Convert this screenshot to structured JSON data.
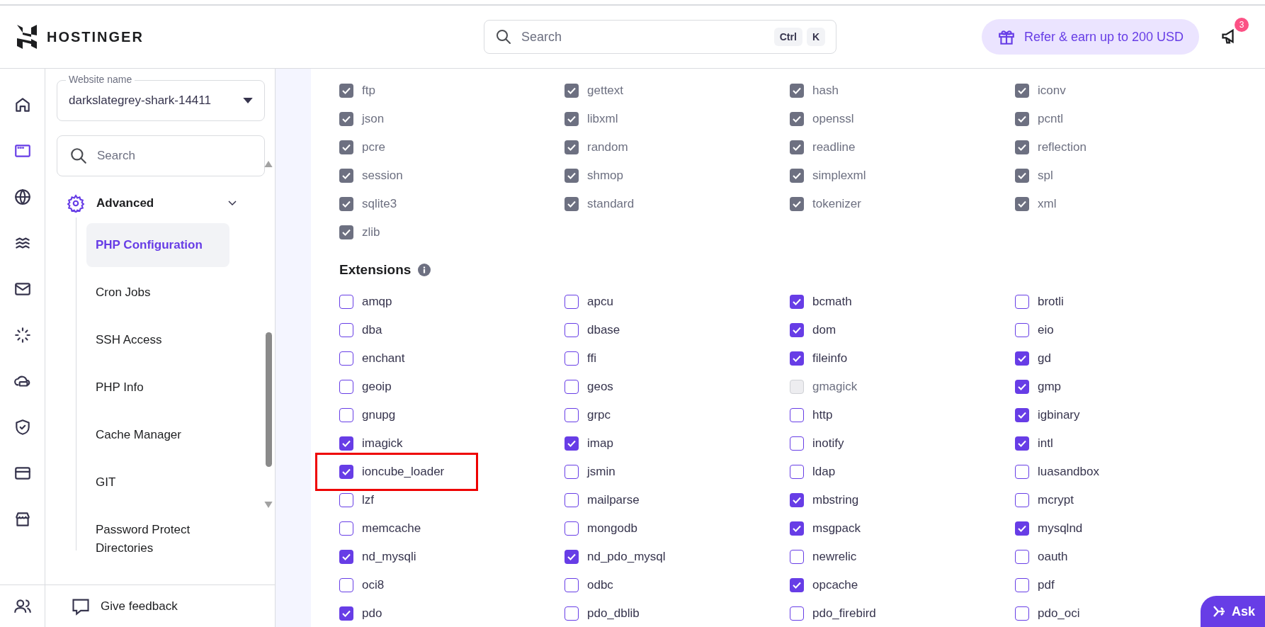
{
  "header": {
    "logo": "HOSTINGER",
    "search": {
      "placeholder": "Search",
      "keys": [
        "Ctrl",
        "K"
      ]
    },
    "refer_button": "Refer & earn up to 200 USD",
    "notifications_badge": "3"
  },
  "rail": {
    "items": [
      {
        "selected": false
      },
      {
        "selected": true
      },
      {
        "selected": false
      },
      {
        "selected": false
      },
      {
        "selected": false
      },
      {
        "selected": false
      },
      {
        "selected": false
      },
      {
        "selected": false
      },
      {
        "selected": false
      },
      {
        "selected": false
      }
    ]
  },
  "sidebar": {
    "website_name": {
      "label": "Website name",
      "value": "darkslategrey-shark-14411"
    },
    "search": {
      "placeholder": "Search"
    },
    "section": {
      "label": "Advanced",
      "expanded": true,
      "items": [
        {
          "label": "PHP Configuration",
          "selected": true
        },
        {
          "label": "Cron Jobs",
          "selected": false
        },
        {
          "label": "SSH Access",
          "selected": false
        },
        {
          "label": "PHP Info",
          "selected": false
        },
        {
          "label": "Cache Manager",
          "selected": false
        },
        {
          "label": "GIT",
          "selected": false
        },
        {
          "label": "Password Protect Directories",
          "selected": false
        }
      ]
    },
    "feedback": "Give feedback"
  },
  "builtin": {
    "items": [
      {
        "name": "ftp",
        "checked": true,
        "disabled": true
      },
      {
        "name": "gettext",
        "checked": true,
        "disabled": true
      },
      {
        "name": "hash",
        "checked": true,
        "disabled": true
      },
      {
        "name": "iconv",
        "checked": true,
        "disabled": true
      },
      {
        "name": "json",
        "checked": true,
        "disabled": true
      },
      {
        "name": "libxml",
        "checked": true,
        "disabled": true
      },
      {
        "name": "openssl",
        "checked": true,
        "disabled": true
      },
      {
        "name": "pcntl",
        "checked": true,
        "disabled": true
      },
      {
        "name": "pcre",
        "checked": true,
        "disabled": true
      },
      {
        "name": "random",
        "checked": true,
        "disabled": true
      },
      {
        "name": "readline",
        "checked": true,
        "disabled": true
      },
      {
        "name": "reflection",
        "checked": true,
        "disabled": true
      },
      {
        "name": "session",
        "checked": true,
        "disabled": true
      },
      {
        "name": "shmop",
        "checked": true,
        "disabled": true
      },
      {
        "name": "simplexml",
        "checked": true,
        "disabled": true
      },
      {
        "name": "spl",
        "checked": true,
        "disabled": true
      },
      {
        "name": "sqlite3",
        "checked": true,
        "disabled": true
      },
      {
        "name": "standard",
        "checked": true,
        "disabled": true
      },
      {
        "name": "tokenizer",
        "checked": true,
        "disabled": true
      },
      {
        "name": "xml",
        "checked": true,
        "disabled": true
      },
      {
        "name": "zlib",
        "checked": true,
        "disabled": true
      }
    ]
  },
  "extensions": {
    "title": "Extensions",
    "items": [
      {
        "name": "amqp",
        "checked": false,
        "disabled": false
      },
      {
        "name": "apcu",
        "checked": false,
        "disabled": false
      },
      {
        "name": "bcmath",
        "checked": true,
        "disabled": false
      },
      {
        "name": "brotli",
        "checked": false,
        "disabled": false
      },
      {
        "name": "dba",
        "checked": false,
        "disabled": false
      },
      {
        "name": "dbase",
        "checked": false,
        "disabled": false
      },
      {
        "name": "dom",
        "checked": true,
        "disabled": false
      },
      {
        "name": "eio",
        "checked": false,
        "disabled": false
      },
      {
        "name": "enchant",
        "checked": false,
        "disabled": false
      },
      {
        "name": "ffi",
        "checked": false,
        "disabled": false
      },
      {
        "name": "fileinfo",
        "checked": true,
        "disabled": false
      },
      {
        "name": "gd",
        "checked": true,
        "disabled": false
      },
      {
        "name": "geoip",
        "checked": false,
        "disabled": false
      },
      {
        "name": "geos",
        "checked": false,
        "disabled": false
      },
      {
        "name": "gmagick",
        "checked": false,
        "disabled": true
      },
      {
        "name": "gmp",
        "checked": true,
        "disabled": false
      },
      {
        "name": "gnupg",
        "checked": false,
        "disabled": false
      },
      {
        "name": "grpc",
        "checked": false,
        "disabled": false
      },
      {
        "name": "http",
        "checked": false,
        "disabled": false
      },
      {
        "name": "igbinary",
        "checked": true,
        "disabled": false
      },
      {
        "name": "imagick",
        "checked": true,
        "disabled": false
      },
      {
        "name": "imap",
        "checked": true,
        "disabled": false
      },
      {
        "name": "inotify",
        "checked": false,
        "disabled": false
      },
      {
        "name": "intl",
        "checked": true,
        "disabled": false
      },
      {
        "name": "ioncube_loader",
        "checked": true,
        "disabled": false,
        "highlighted": true
      },
      {
        "name": "jsmin",
        "checked": false,
        "disabled": false
      },
      {
        "name": "ldap",
        "checked": false,
        "disabled": false
      },
      {
        "name": "luasandbox",
        "checked": false,
        "disabled": false
      },
      {
        "name": "lzf",
        "checked": false,
        "disabled": false
      },
      {
        "name": "mailparse",
        "checked": false,
        "disabled": false
      },
      {
        "name": "mbstring",
        "checked": true,
        "disabled": false
      },
      {
        "name": "mcrypt",
        "checked": false,
        "disabled": false
      },
      {
        "name": "memcache",
        "checked": false,
        "disabled": false
      },
      {
        "name": "mongodb",
        "checked": false,
        "disabled": false
      },
      {
        "name": "msgpack",
        "checked": true,
        "disabled": false
      },
      {
        "name": "mysqlnd",
        "checked": true,
        "disabled": false
      },
      {
        "name": "nd_mysqli",
        "checked": true,
        "disabled": false
      },
      {
        "name": "nd_pdo_mysql",
        "checked": true,
        "disabled": false
      },
      {
        "name": "newrelic",
        "checked": false,
        "disabled": false
      },
      {
        "name": "oauth",
        "checked": false,
        "disabled": false
      },
      {
        "name": "oci8",
        "checked": false,
        "disabled": false
      },
      {
        "name": "odbc",
        "checked": false,
        "disabled": false
      },
      {
        "name": "opcache",
        "checked": true,
        "disabled": false
      },
      {
        "name": "pdf",
        "checked": false,
        "disabled": false
      },
      {
        "name": "pdo",
        "checked": true,
        "disabled": false
      },
      {
        "name": "pdo_dblib",
        "checked": false,
        "disabled": false
      },
      {
        "name": "pdo_firebird",
        "checked": false,
        "disabled": false
      },
      {
        "name": "pdo_oci",
        "checked": false,
        "disabled": false
      }
    ]
  },
  "ask_button": "Ask"
}
